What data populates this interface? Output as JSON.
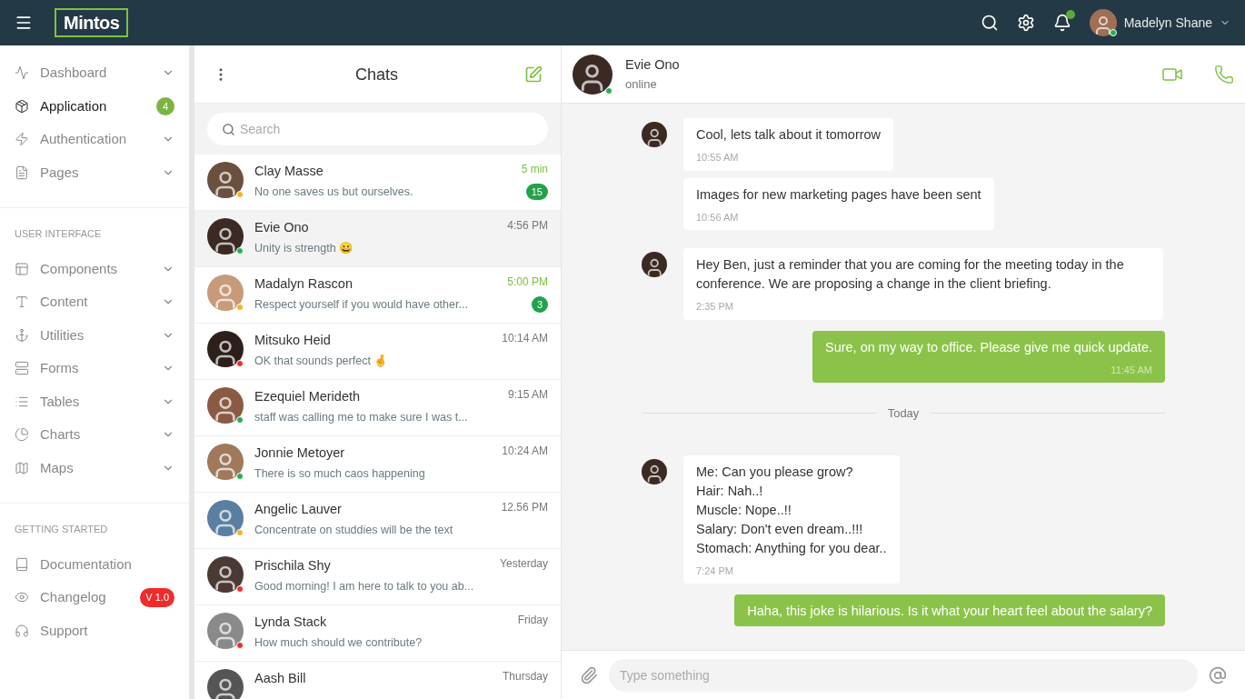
{
  "topbar": {
    "logo": "Mintos",
    "user": {
      "name": "Madelyn Shane",
      "online": true
    },
    "notification_dot": true
  },
  "sidebar": {
    "sections": [
      {
        "items": [
          {
            "label": "Dashboard",
            "selected": false,
            "expandable": true
          },
          {
            "label": "Application",
            "selected": true,
            "expandable": false,
            "badge": "4",
            "color": "#7cb342"
          },
          {
            "label": "Authentication",
            "selected": false,
            "expandable": true
          },
          {
            "label": "Pages",
            "selected": false,
            "expandable": true
          }
        ]
      },
      {
        "heading": "USER INTERFACE",
        "items": [
          {
            "label": "Components",
            "selected": false,
            "expandable": true
          },
          {
            "label": "Content",
            "selected": false,
            "expandable": true
          },
          {
            "label": "Utilities",
            "selected": false,
            "expandable": true
          },
          {
            "label": "Forms",
            "selected": false,
            "expandable": true
          },
          {
            "label": "Tables",
            "selected": false,
            "expandable": true
          },
          {
            "label": "Charts",
            "selected": false,
            "expandable": true
          },
          {
            "label": "Maps",
            "selected": false,
            "expandable": true
          }
        ]
      },
      {
        "heading": "GETTING STARTED",
        "items": [
          {
            "label": "Documentation",
            "selected": false,
            "expandable": false
          },
          {
            "label": "Changelog",
            "selected": false,
            "expandable": false,
            "badge": "V 1.0",
            "color": "#ef2b2b"
          },
          {
            "label": "Support",
            "selected": false,
            "expandable": false
          }
        ]
      }
    ]
  },
  "chats": {
    "title": "Chats",
    "search": {
      "placeholder": "Search"
    },
    "items": [
      {
        "name": "Clay Masse",
        "preview": "No one saves us but ourselves.",
        "time": "5 min",
        "highlight": true,
        "unread": "15",
        "color": "#f5b225",
        "selected": false
      },
      {
        "name": "Evie Ono",
        "preview": "Unity is strength 😀",
        "time": "4:56 PM",
        "highlight": false,
        "color": "#22b14c",
        "selected": true
      },
      {
        "name": "Madalyn Rascon",
        "preview": "Respect yourself if you would have other...",
        "time": "5:00 PM",
        "highlight": true,
        "unread": "3",
        "color": "#f5b225",
        "selected": false
      },
      {
        "name": "Mitsuko Heid",
        "preview": "OK that sounds perfect 🤞",
        "time": "10:14 AM",
        "highlight": false,
        "color": "#ef2b2b",
        "selected": false
      },
      {
        "name": "Ezequiel Merideth",
        "preview": "staff was calling me to make sure I was t...",
        "time": "9:15 AM",
        "highlight": false,
        "color": "#22b14c",
        "selected": false
      },
      {
        "name": "Jonnie Metoyer",
        "preview": "There is so much caos happening",
        "time": "10:24 AM",
        "highlight": false,
        "color": "#22b14c",
        "selected": false
      },
      {
        "name": "Angelic Lauver",
        "preview": "Concentrate on studdies will be the text",
        "time": "12.56 PM",
        "highlight": false,
        "color": "#f5b225",
        "selected": false
      },
      {
        "name": "Prischila Shy",
        "preview": "Good morning! I am here to talk to you ab...",
        "time": "Yesterday",
        "highlight": false,
        "color": "#ef2b2b",
        "selected": false
      },
      {
        "name": "Lynda Stack",
        "preview": "How much should we contribute?",
        "time": "Friday",
        "highlight": false,
        "color": "#ef2b2b",
        "selected": false
      },
      {
        "name": "Aash Bill",
        "time": "Thursday",
        "highlight": false,
        "selected": false
      }
    ]
  },
  "conversation": {
    "name": "Evie Ono",
    "status": "online",
    "online": true,
    "messages": [
      {
        "kind": "in",
        "avatar": true,
        "text": "Cool, lets talk about it tomorrow",
        "time": "10:55 AM"
      },
      {
        "kind": "in",
        "avatar": false,
        "text": "Images for new marketing pages have been sent",
        "time": "10:56 AM"
      },
      {
        "kind": "in",
        "avatar": true,
        "text": "Hey Ben, just a reminder that you are coming for the meeting today in the conference. We are proposing a change in the client briefing.",
        "time": "2:35 PM"
      },
      {
        "kind": "out",
        "text": "Sure, on my way to office. Please give me quick update.",
        "time": "11:45 AM"
      },
      {
        "kind": "divider",
        "text": "Today"
      },
      {
        "kind": "in",
        "avatar": true,
        "text": "Me: Can you please grow?\nHair: Nah..!\nMuscle: Nope..!!\nSalary: Don't even dream..!!!\nStomach: Anything for you dear..",
        "time": "7:24 PM"
      },
      {
        "kind": "out",
        "text": "Haha, this joke is hilarious. Is it what your heart feel about the salary?"
      }
    ],
    "composer": {
      "placeholder": "Type something"
    }
  }
}
